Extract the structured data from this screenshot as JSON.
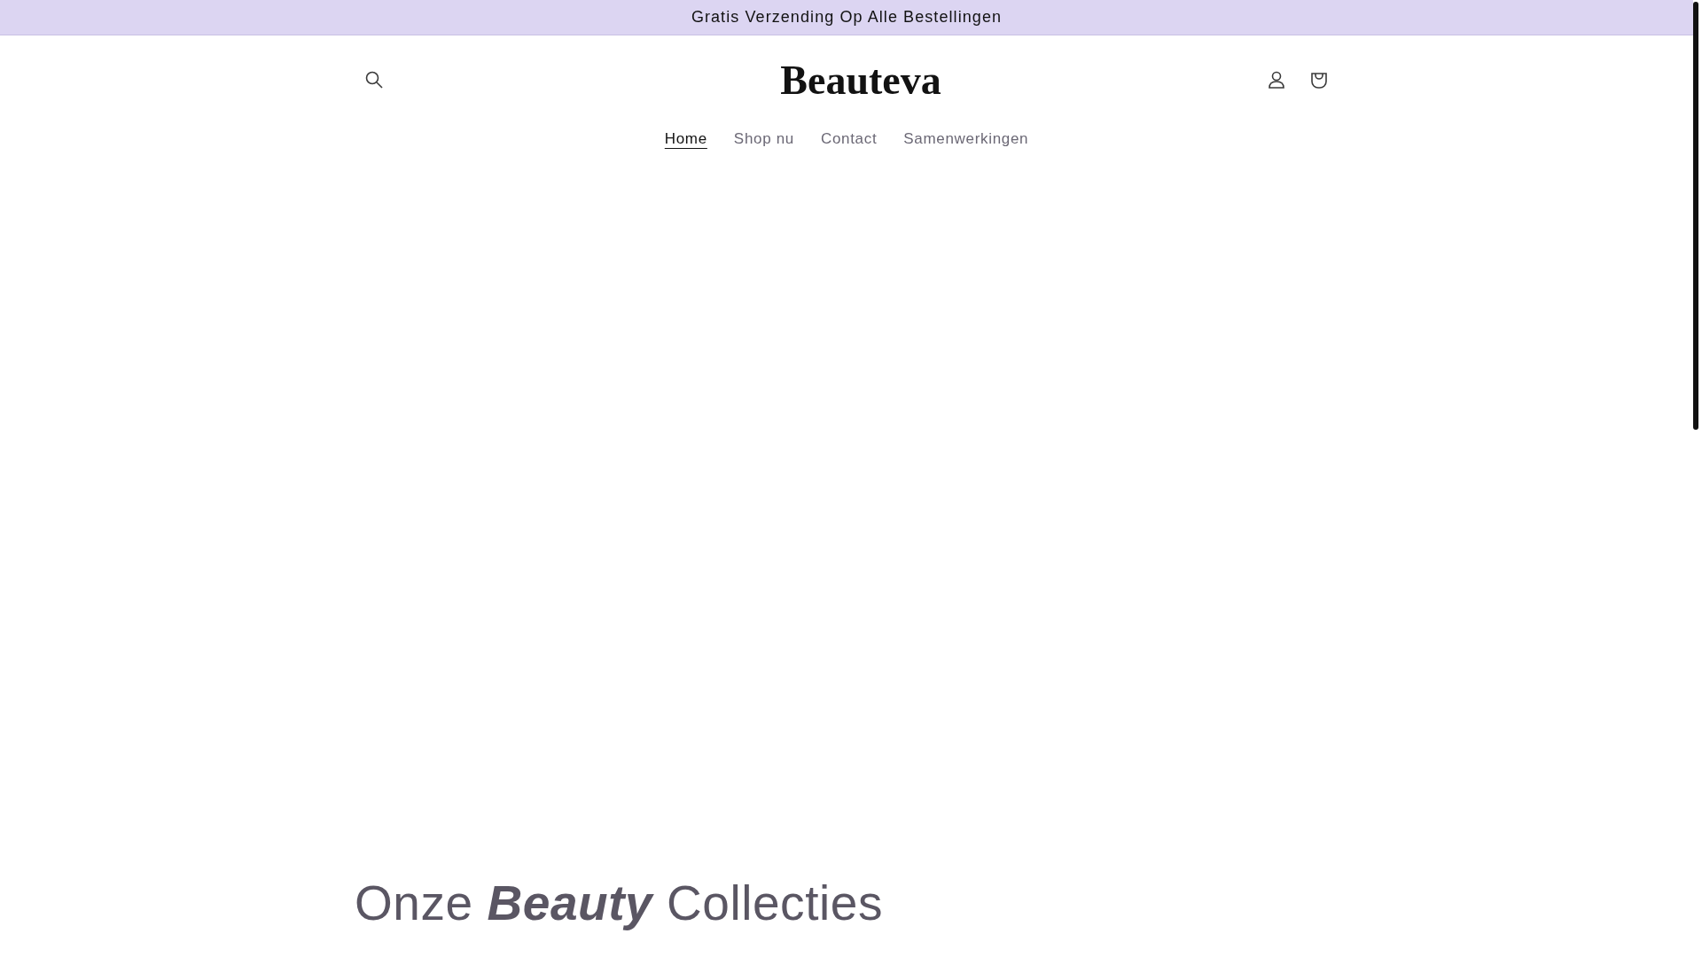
{
  "announcement": "Gratis Verzending Op Alle Bestellingen",
  "header": {
    "logo": "Beauteva"
  },
  "nav": [
    {
      "label": "Home",
      "selected": true
    },
    {
      "label": "Shop nu",
      "selected": false
    },
    {
      "label": "Contact",
      "selected": false
    },
    {
      "label": "Samenwerkingen",
      "selected": false
    }
  ],
  "heading": "Onze **Beauty** Collecties"
}
